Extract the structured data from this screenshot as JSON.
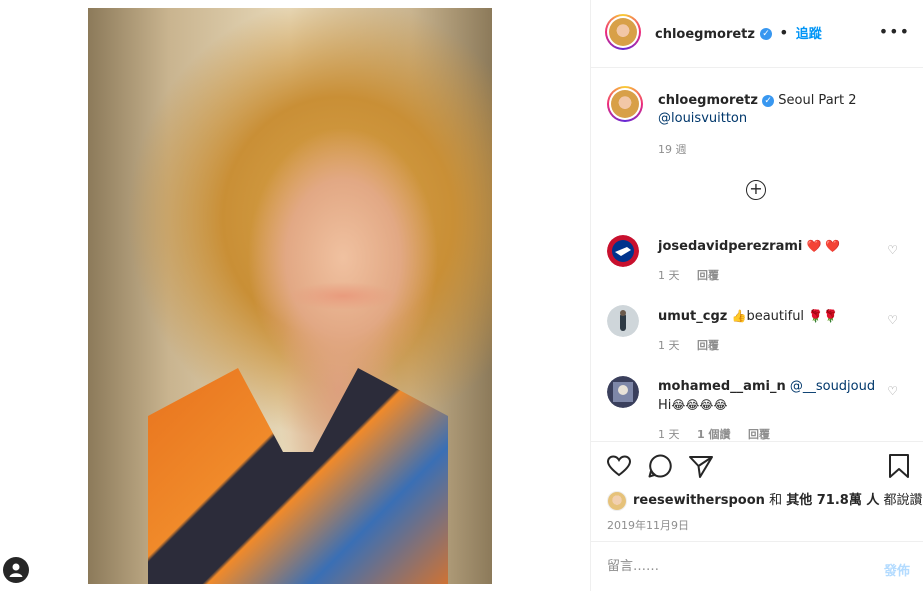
{
  "post": {
    "author": "chloegmoretz",
    "follow_label": "追蹤",
    "separator": "•",
    "verified_mark": "✓",
    "caption_text": "Seoul Part 2",
    "caption_mention": "@louisvuitton",
    "caption_age": "19 週",
    "more_icon": "more-horizontal-icon",
    "add_comment_icon": "plus-circle-icon"
  },
  "comments": [
    {
      "user": "josedavidperezrami",
      "text": "",
      "emoji": "❤️ ❤️",
      "age": "1 天",
      "likes": "",
      "reply": "回覆"
    },
    {
      "user": "umut_cgz",
      "text": "beautiful",
      "emoji_prefix": "👍",
      "emoji": "🌹🌹",
      "age": "1 天",
      "likes": "",
      "reply": "回覆"
    },
    {
      "user": "mohamed__ami_n",
      "mention": "@__soudjoud",
      "text": "Hi",
      "emoji": "😂😂😂😂",
      "age": "1 天",
      "likes": "1 個讚",
      "reply": "回覆"
    }
  ],
  "actions": {
    "like_icon": "heart-icon",
    "comment_icon": "comment-icon",
    "share_icon": "share-icon",
    "save_icon": "bookmark-icon"
  },
  "likes": {
    "user": "reesewitherspoon",
    "and": "和",
    "others": "其他 71.8萬 人",
    "suffix": "都說讚"
  },
  "date": "2019年11月9日",
  "comment_box": {
    "placeholder": "留言……",
    "post_label": "發佈"
  },
  "colors": {
    "link_blue": "#0095f6",
    "verified_blue": "#3897f0",
    "post_disabled": "#b3dbff",
    "muted": "#8e8e8e"
  }
}
